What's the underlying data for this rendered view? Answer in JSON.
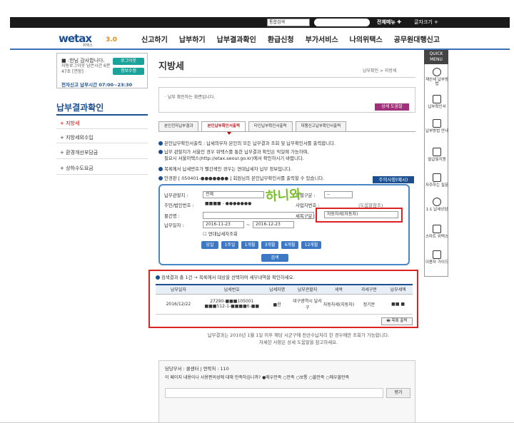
{
  "topbar": {
    "select": "통합검색",
    "all_menu": "전체메뉴 ✚",
    "font_size": "글자크기 +"
  },
  "logo": {
    "main": "wetax",
    "sub": "위택스",
    "ver": "3.0"
  },
  "gnb": [
    "신고하기",
    "납부하기",
    "납부결과확인",
    "환급신청",
    "부가서비스",
    "나의위택스",
    "공무원대행신고"
  ],
  "login": {
    "greet": "■ :한님 감사합니다.",
    "remain": "자동로그아웃 남은시간 6분 47초 [연장]",
    "logout": "로그아웃",
    "info": "정보수정",
    "time": "전자신고 납부시간 07:00~23:30"
  },
  "sidebar": {
    "title": "납부결과확인",
    "items": [
      "지방세",
      "지방세외수입",
      "환경개선부담금",
      "상하수도요금"
    ]
  },
  "page": {
    "title": "지방세",
    "breadcrumb": "납부확인 > 지방세",
    "notice": "· 납부 확인하는 화면입니다.",
    "help": "상세 도움말"
  },
  "tabs": [
    "본인전자납부결과",
    "본인납부확인서출력",
    "타인납부확인서출력",
    "대행신고납부확인서출력"
  ],
  "info_lines": [
    "본인납부확인서출력 : 납세의무자 본인의 모든 납부결과 조회 및 납부확인서를 출력합니다.",
    "납부 관할지가 서울인 경우 위택스를 통한 납부결과 확인은 익일에 가능하며,",
    "필요시 서울이택스(http://etax.seoul.go.kr)에서 확인하시기 바랍니다.",
    "목록에서 납세번호가 빨간색인 경우는 연대납세자 납부 정보입니다.",
    "안경판 [ 050401-●●●●●●● ] 회원님의 본인납부확인서를 출력할 수 있습니다."
  ],
  "caution": "주의사항(예시)",
  "search": {
    "region_label": "납부관할지 :",
    "region_value": "전체",
    "type_label": "정렬구분 :",
    "type_value": "--",
    "id_label": "주민/법인번호 :",
    "id_value": "■■■■ - ●●●●●●●",
    "biz_label": "사업자번호 :",
    "biz_hint": "(도움말참조)",
    "item_label": "물건명 :",
    "tax_label": "세목구분 :",
    "tax_value": "자동차세(자동차)",
    "date_label": "납부일자 :",
    "date_from": "2016-11-23",
    "date_to": "2016-12-23",
    "joint": "연대납세자조회",
    "periods": [
      "당일",
      "1주일",
      "1개월",
      "3개월",
      "6개월",
      "12개월"
    ],
    "search_btn": "검색"
  },
  "stamp": "하니와",
  "result": {
    "summary": "검색결과 총 1건 → 목록에서 대상을 선택하여 세부내역을 확인하세요.",
    "headers": [
      "납부일자",
      "납세번호",
      "납세자명",
      "납부관할지",
      "세목",
      "과세구분",
      "납부세액"
    ],
    "rows": [
      {
        "date": "2016/12/22",
        "no": "27290-■■■105001 ■■■512-1-■■■■6-■■",
        "name": "■한",
        "region": "대구광역시 달서구",
        "tax": "자동차세(자동차)",
        "kind": "정기분",
        "amount": "■■ ■"
      }
    ],
    "print": "목록 출력"
  },
  "footnote": [
    "납부결과는 2010년 1월 1일 이후 해당 시군구에 전산수납처리 한 경우에만 조회가 가능합니다.",
    "자세한 사항은 상세 도움말을 참고하세요."
  ],
  "survey": {
    "head": "담당부서 : 콜센터 | 연락처 : 110",
    "q": "이 페이지 내용이나 사용편의성에 대해 만족하십니까? ●매우만족 ○만족 ○보통 ○불만족 ○매우불만족",
    "btn": "평가"
  },
  "quick": {
    "head": "QUICK MENU",
    "items": [
      "재산세 납부방법",
      "납부확인서",
      "납부방법 안내",
      "발급및지원",
      "자주하는 질문",
      "1:1 납세상담",
      "스마트 위택스",
      "이용자 가이드"
    ]
  }
}
